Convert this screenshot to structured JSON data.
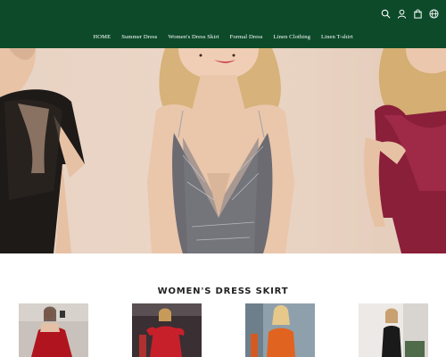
{
  "header": {
    "background": "#0c4a2a",
    "icons": [
      "search-icon",
      "user-icon",
      "bag-icon",
      "globe-icon"
    ]
  },
  "nav": {
    "items": [
      {
        "label": "HOME"
      },
      {
        "label": "Summer Dress"
      },
      {
        "label": "Women's Dress Skirt"
      },
      {
        "label": "Formal Dress"
      },
      {
        "label": "Linen Clothing"
      },
      {
        "label": "Linen T-shirt"
      }
    ]
  },
  "section": {
    "title": "WOMEN'S DRESS SKIRT"
  },
  "colors": {
    "brand_green": "#0c4a2a",
    "hero_background": "#e6d0c0"
  }
}
